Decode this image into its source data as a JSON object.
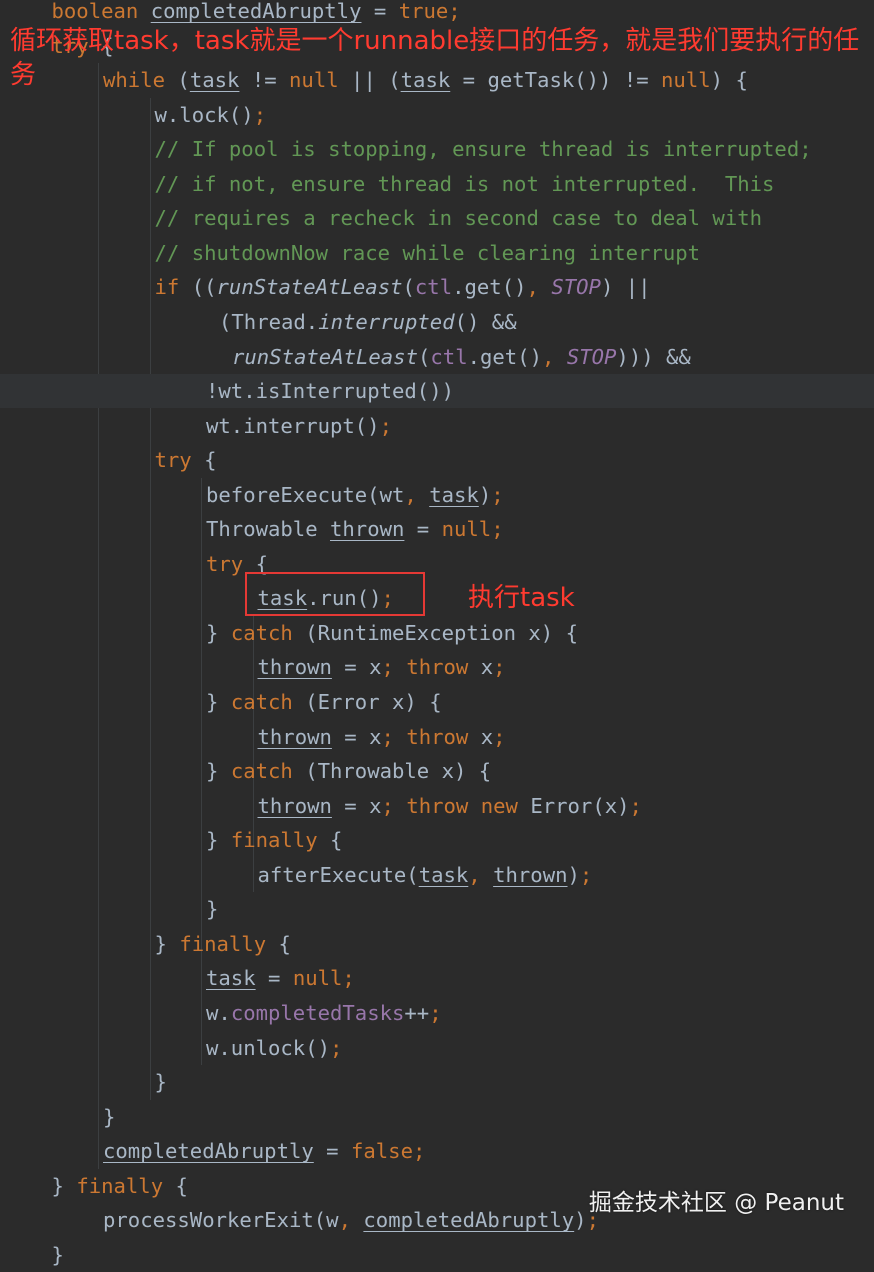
{
  "colors": {
    "background": "#2b2b2b",
    "default": "#a9b7c6",
    "keyword": "#cc7832",
    "comment": "#629755",
    "field": "#9876aa",
    "annotation": "#ff3b30",
    "box": "#e53935",
    "watermark": "#f0f0f0"
  },
  "code": [
    {
      "indent": 1,
      "tokens": [
        {
          "t": "boolean",
          "c": "kw"
        },
        {
          "t": " "
        },
        {
          "t": "completedAbruptly",
          "c": "u"
        },
        {
          "t": " = "
        },
        {
          "t": "true",
          "c": "kw"
        },
        {
          "t": ";",
          "c": "kw"
        }
      ]
    },
    {
      "indent": 1,
      "tokens": [
        {
          "t": "try",
          "c": "kw"
        },
        {
          "t": " {"
        }
      ]
    },
    {
      "indent": 2,
      "tokens": [
        {
          "t": "while",
          "c": "kw"
        },
        {
          "t": " ("
        },
        {
          "t": "task",
          "c": "u"
        },
        {
          "t": " != "
        },
        {
          "t": "null",
          "c": "kw"
        },
        {
          "t": " || ("
        },
        {
          "t": "task",
          "c": "u"
        },
        {
          "t": " = getTask()) != "
        },
        {
          "t": "null",
          "c": "kw"
        },
        {
          "t": ") {"
        }
      ]
    },
    {
      "indent": 3,
      "tokens": [
        {
          "t": "w.lock()"
        },
        {
          "t": ";",
          "c": "kw"
        }
      ]
    },
    {
      "indent": 3,
      "tokens": [
        {
          "t": "// If pool is stopping, ensure thread is interrupted;",
          "c": "cm"
        }
      ]
    },
    {
      "indent": 3,
      "tokens": [
        {
          "t": "// if not, ensure thread is not interrupted.  This",
          "c": "cm"
        }
      ]
    },
    {
      "indent": 3,
      "tokens": [
        {
          "t": "// requires a recheck in second case to deal with",
          "c": "cm"
        }
      ]
    },
    {
      "indent": 3,
      "tokens": [
        {
          "t": "// shutdownNow race while clearing interrupt",
          "c": "cm"
        }
      ]
    },
    {
      "indent": 3,
      "tokens": [
        {
          "t": "if",
          "c": "kw"
        },
        {
          "t": " (("
        },
        {
          "t": "runStateAtLeast",
          "c": "sm"
        },
        {
          "t": "("
        },
        {
          "t": "ctl",
          "c": "fld"
        },
        {
          "t": ".get()"
        },
        {
          "t": ", ",
          "c": "kw"
        },
        {
          "t": "STOP",
          "c": "const"
        },
        {
          "t": ") ||"
        }
      ]
    },
    {
      "indent": 4,
      "pad": 1,
      "tokens": [
        {
          "t": "(Thread."
        },
        {
          "t": "interrupted",
          "c": "sm"
        },
        {
          "t": "() &&"
        }
      ]
    },
    {
      "indent": 4,
      "pad": 2,
      "tokens": [
        {
          "t": "runStateAtLeast",
          "c": "sm"
        },
        {
          "t": "("
        },
        {
          "t": "ctl",
          "c": "fld"
        },
        {
          "t": ".get()"
        },
        {
          "t": ", ",
          "c": "kw"
        },
        {
          "t": "STOP",
          "c": "const"
        },
        {
          "t": "))) &&"
        }
      ]
    },
    {
      "indent": 4,
      "hl": true,
      "tokens": [
        {
          "t": "!wt."
        },
        {
          "t": "isInterrupted",
          "c": "mt"
        },
        {
          "t": "())"
        }
      ]
    },
    {
      "indent": 4,
      "tokens": [
        {
          "t": "wt.interrupt()"
        },
        {
          "t": ";",
          "c": "kw"
        }
      ]
    },
    {
      "indent": 3,
      "tokens": [
        {
          "t": "try",
          "c": "kw"
        },
        {
          "t": " {"
        }
      ]
    },
    {
      "indent": 4,
      "tokens": [
        {
          "t": "beforeExecute(wt"
        },
        {
          "t": ", ",
          "c": "kw"
        },
        {
          "t": "task",
          "c": "u"
        },
        {
          "t": ")"
        },
        {
          "t": ";",
          "c": "kw"
        }
      ]
    },
    {
      "indent": 4,
      "tokens": [
        {
          "t": "Throwable "
        },
        {
          "t": "thrown",
          "c": "u"
        },
        {
          "t": " = "
        },
        {
          "t": "null",
          "c": "kw"
        },
        {
          "t": ";",
          "c": "kw"
        }
      ]
    },
    {
      "indent": 4,
      "tokens": [
        {
          "t": "try",
          "c": "kw"
        },
        {
          "t": " {"
        }
      ]
    },
    {
      "indent": 5,
      "tokens": [
        {
          "t": "task",
          "c": "u"
        },
        {
          "t": ".run()"
        },
        {
          "t": ";",
          "c": "kw"
        }
      ]
    },
    {
      "indent": 4,
      "tokens": [
        {
          "t": "} "
        },
        {
          "t": "catch",
          "c": "kw"
        },
        {
          "t": " (RuntimeException x) {"
        }
      ]
    },
    {
      "indent": 5,
      "tokens": [
        {
          "t": "thrown",
          "c": "u"
        },
        {
          "t": " = x"
        },
        {
          "t": "; ",
          "c": "kw"
        },
        {
          "t": "throw",
          "c": "kw"
        },
        {
          "t": " x"
        },
        {
          "t": ";",
          "c": "kw"
        }
      ]
    },
    {
      "indent": 4,
      "tokens": [
        {
          "t": "} "
        },
        {
          "t": "catch",
          "c": "kw"
        },
        {
          "t": " (Error x) {"
        }
      ]
    },
    {
      "indent": 5,
      "tokens": [
        {
          "t": "thrown",
          "c": "u"
        },
        {
          "t": " = x"
        },
        {
          "t": "; ",
          "c": "kw"
        },
        {
          "t": "throw",
          "c": "kw"
        },
        {
          "t": " x"
        },
        {
          "t": ";",
          "c": "kw"
        }
      ]
    },
    {
      "indent": 4,
      "tokens": [
        {
          "t": "} "
        },
        {
          "t": "catch",
          "c": "kw"
        },
        {
          "t": " (Throwable x) {"
        }
      ]
    },
    {
      "indent": 5,
      "tokens": [
        {
          "t": "thrown",
          "c": "u"
        },
        {
          "t": " = x"
        },
        {
          "t": "; ",
          "c": "kw"
        },
        {
          "t": "throw new",
          "c": "kw"
        },
        {
          "t": " Error(x)"
        },
        {
          "t": ";",
          "c": "kw"
        }
      ]
    },
    {
      "indent": 4,
      "tokens": [
        {
          "t": "} "
        },
        {
          "t": "finally",
          "c": "kw"
        },
        {
          "t": " {"
        }
      ]
    },
    {
      "indent": 5,
      "tokens": [
        {
          "t": "afterExecute("
        },
        {
          "t": "task",
          "c": "u"
        },
        {
          "t": ", ",
          "c": "kw"
        },
        {
          "t": "thrown",
          "c": "u"
        },
        {
          "t": ")"
        },
        {
          "t": ";",
          "c": "kw"
        }
      ]
    },
    {
      "indent": 4,
      "tokens": [
        {
          "t": "}"
        }
      ]
    },
    {
      "indent": 3,
      "tokens": [
        {
          "t": "} "
        },
        {
          "t": "finally",
          "c": "kw"
        },
        {
          "t": " {"
        }
      ]
    },
    {
      "indent": 4,
      "tokens": [
        {
          "t": "task",
          "c": "u"
        },
        {
          "t": " = "
        },
        {
          "t": "null",
          "c": "kw"
        },
        {
          "t": ";",
          "c": "kw"
        }
      ]
    },
    {
      "indent": 4,
      "tokens": [
        {
          "t": "w."
        },
        {
          "t": "completedTasks",
          "c": "fld"
        },
        {
          "t": "++"
        },
        {
          "t": ";",
          "c": "kw"
        }
      ]
    },
    {
      "indent": 4,
      "tokens": [
        {
          "t": "w.unlock()"
        },
        {
          "t": ";",
          "c": "kw"
        }
      ]
    },
    {
      "indent": 3,
      "tokens": [
        {
          "t": "}"
        }
      ]
    },
    {
      "indent": 2,
      "tokens": [
        {
          "t": "}"
        }
      ]
    },
    {
      "indent": 2,
      "tokens": [
        {
          "t": "completedAbruptly",
          "c": "u"
        },
        {
          "t": " = "
        },
        {
          "t": "false",
          "c": "kw"
        },
        {
          "t": ";",
          "c": "kw"
        }
      ]
    },
    {
      "indent": 1,
      "tokens": [
        {
          "t": "} "
        },
        {
          "t": "finally",
          "c": "kw"
        },
        {
          "t": " {"
        }
      ]
    },
    {
      "indent": 2,
      "tokens": [
        {
          "t": "processWorkerExit(w"
        },
        {
          "t": ", ",
          "c": "kw"
        },
        {
          "t": "completedAbruptly",
          "c": "u"
        },
        {
          "t": ")"
        },
        {
          "t": ";",
          "c": "kw"
        }
      ]
    },
    {
      "indent": 1,
      "tokens": [
        {
          "t": "}"
        }
      ]
    }
  ],
  "annotations": {
    "loop_note": "循环获取task，task就是一个runnable接口的任务，就是我们要执行的任务",
    "run_note": "执行task"
  },
  "watermark": "掘金技术社区 @ Peanut"
}
